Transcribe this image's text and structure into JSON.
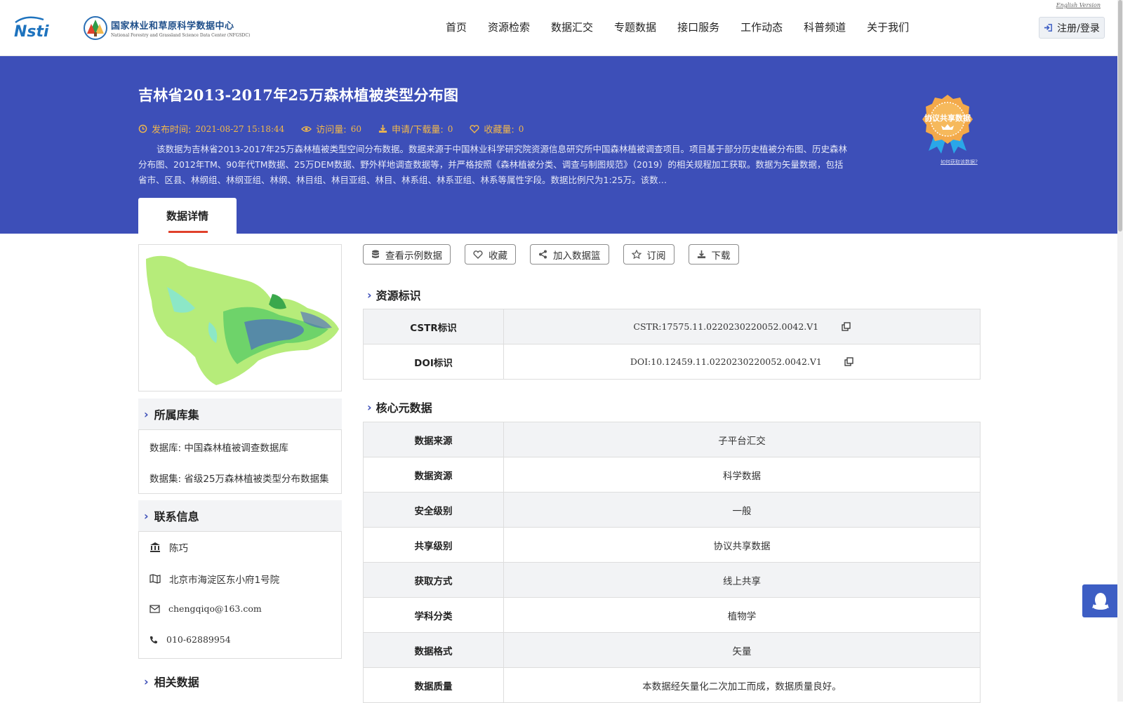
{
  "header": {
    "logo_cn": "国家林业和草原科学数据中心",
    "logo_en": "National Forestry and Grassland Science Data Center (NFGSDC)",
    "english_link": "English Version",
    "nav": [
      "首页",
      "资源检索",
      "数据汇交",
      "专题数据",
      "接口服务",
      "工作动态",
      "科普频道",
      "关于我们"
    ],
    "login": "注册/登录"
  },
  "banner": {
    "title": "吉林省2013-2017年25万森林植被类型分布图",
    "publish_label": "发布时间:",
    "publish_value": "2021-08-27 15:18:44",
    "visits_label": "访问量:",
    "visits_value": "60",
    "downloads_label": "申请/下载量:",
    "downloads_value": "0",
    "favorites_label": "收藏量:",
    "favorites_value": "0",
    "description": "该数据为吉林省2013-2017年25万森林植被类型空间分布数据。数据来源于中国林业科学研究院资源信息研究所中国森林植被调查项目。项目基于部分历史植被分布图、历史森林分布图、2012年TM、90年代TM数据、25万DEM数据、野外样地调查数据等，并严格按照《森林植被分类、调查与制图规范》（2019）的相关规程加工获取。数据为矢量数据，包括省市、区县、林纲组、林纲亚组、林纲、林目组、林目亚组、林目、林系组、林系亚组、林系等属性字段。数据比例尺为1:25万。该数…",
    "badge_text": "协议共享数据",
    "badge_link": "如何获取该数据?",
    "tab": "数据详情"
  },
  "sidebar": {
    "library_title": "所属库集",
    "database_label": "数据库:",
    "database_value": "中国森林植被调查数据库",
    "dataset_label": "数据集:",
    "dataset_value": "省级25万森林植被类型分布数据集",
    "contact_title": "联系信息",
    "contact_name": "陈巧",
    "contact_address": "北京市海淀区东小府1号院",
    "contact_email": "chengqiqo@163.com",
    "contact_phone": "010-62889954",
    "related_title": "相关数据"
  },
  "actions": [
    "查看示例数据",
    "收藏",
    "加入数据篮",
    "订阅",
    "下载"
  ],
  "resource_id": {
    "title": "资源标识",
    "rows": [
      {
        "key": "CSTR标识",
        "value": "CSTR:17575.11.0220230220052.0042.V1"
      },
      {
        "key": "DOI标识",
        "value": "DOI:10.12459.11.0220230220052.0042.V1"
      }
    ]
  },
  "core_meta": {
    "title": "核心元数据",
    "rows": [
      {
        "key": "数据来源",
        "value": "子平台汇交"
      },
      {
        "key": "数据资源",
        "value": "科学数据"
      },
      {
        "key": "安全级别",
        "value": "一般"
      },
      {
        "key": "共享级别",
        "value": "协议共享数据"
      },
      {
        "key": "获取方式",
        "value": "线上共享"
      },
      {
        "key": "学科分类",
        "value": "植物学"
      },
      {
        "key": "数据格式",
        "value": "矢量"
      },
      {
        "key": "数据质量",
        "value": "本数据经矢量化二次加工而成，数据质量良好。"
      }
    ]
  },
  "colors": {
    "banner": "#3d4fb8",
    "meta": "#f2b84b",
    "tab_underline": "#e0412c"
  }
}
